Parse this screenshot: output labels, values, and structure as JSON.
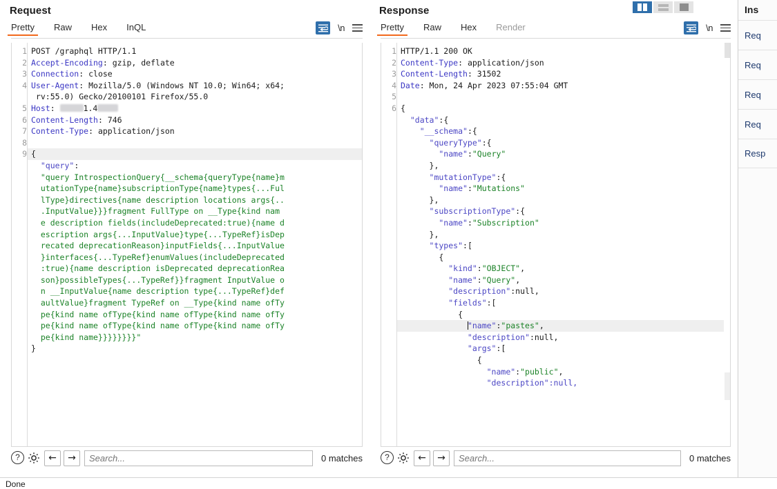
{
  "request": {
    "title": "Request",
    "tabs": [
      {
        "label": "Pretty",
        "active": true,
        "disabled": false
      },
      {
        "label": "Raw",
        "active": false,
        "disabled": false
      },
      {
        "label": "Hex",
        "active": false,
        "disabled": false
      },
      {
        "label": "InQL",
        "active": false,
        "disabled": false
      }
    ],
    "tools": {
      "wrap": "word-wrap-toggle",
      "newline": "\\n",
      "menu": "hamburger-menu"
    },
    "lines": [
      {
        "n": "1",
        "segments": [
          {
            "t": "POST /graphql HTTP/1.1",
            "c": "punct"
          }
        ]
      },
      {
        "n": "2",
        "segments": [
          {
            "t": "Accept-Encoding",
            "c": "hdr-name"
          },
          {
            "t": ": gzip, deflate",
            "c": "hdr-val"
          }
        ]
      },
      {
        "n": "3",
        "segments": [
          {
            "t": "Connection",
            "c": "hdr-name"
          },
          {
            "t": ": close",
            "c": "hdr-val"
          }
        ]
      },
      {
        "n": "4",
        "segments": [
          {
            "t": "User-Agent",
            "c": "hdr-name"
          },
          {
            "t": ": Mozilla/5.0 (Windows NT 10.0; Win64; x64;",
            "c": "hdr-val"
          }
        ]
      },
      {
        "n": "",
        "segments": [
          {
            "t": " rv:55.0) Gecko/20100101 Firefox/55.0",
            "c": "hdr-val"
          }
        ]
      },
      {
        "n": "5",
        "segments": [
          {
            "t": "Host",
            "c": "hdr-name"
          },
          {
            "t": ": ",
            "c": "hdr-val"
          },
          {
            "t": "REDACT:34",
            "c": "redact"
          },
          {
            "t": "1.4",
            "c": "hdr-val"
          },
          {
            "t": "REDACT:30",
            "c": "redact"
          }
        ]
      },
      {
        "n": "6",
        "segments": [
          {
            "t": "Content-Length",
            "c": "hdr-name"
          },
          {
            "t": ": 746",
            "c": "hdr-val"
          }
        ]
      },
      {
        "n": "7",
        "segments": [
          {
            "t": "Content-Type",
            "c": "hdr-name"
          },
          {
            "t": ": application/json",
            "c": "hdr-val"
          }
        ]
      },
      {
        "n": "8",
        "segments": []
      },
      {
        "n": "9",
        "highlight": true,
        "segments": [
          {
            "t": "{",
            "c": "punct"
          }
        ]
      },
      {
        "n": "",
        "segments": [
          {
            "t": "  \"query\"",
            "c": "jkey"
          },
          {
            "t": ":",
            "c": "punct"
          }
        ]
      },
      {
        "n": "",
        "segments": [
          {
            "t": "  \"query IntrospectionQuery{__schema{queryType{name}m",
            "c": "gq"
          }
        ]
      },
      {
        "n": "",
        "segments": [
          {
            "t": "  utationType{name}subscriptionType{name}types{...Ful",
            "c": "gq"
          }
        ]
      },
      {
        "n": "",
        "segments": [
          {
            "t": "  lType}directives{name description locations args{..",
            "c": "gq"
          }
        ]
      },
      {
        "n": "",
        "segments": [
          {
            "t": "  .InputValue}}}fragment FullType on __Type{kind nam",
            "c": "gq"
          }
        ]
      },
      {
        "n": "",
        "segments": [
          {
            "t": "  e description fields(includeDeprecated:true){name d",
            "c": "gq"
          }
        ]
      },
      {
        "n": "",
        "segments": [
          {
            "t": "  escription args{...InputValue}type{...TypeRef}isDep",
            "c": "gq"
          }
        ]
      },
      {
        "n": "",
        "segments": [
          {
            "t": "  recated deprecationReason}inputFields{...InputValue",
            "c": "gq"
          }
        ]
      },
      {
        "n": "",
        "segments": [
          {
            "t": "  }interfaces{...TypeRef}enumValues(includeDeprecated",
            "c": "gq"
          }
        ]
      },
      {
        "n": "",
        "segments": [
          {
            "t": "  :true){name description isDeprecated deprecationRea",
            "c": "gq"
          }
        ]
      },
      {
        "n": "",
        "segments": [
          {
            "t": "  son}possibleTypes{...TypeRef}}fragment InputValue o",
            "c": "gq"
          }
        ]
      },
      {
        "n": "",
        "segments": [
          {
            "t": "  n __InputValue{name description type{...TypeRef}def",
            "c": "gq"
          }
        ]
      },
      {
        "n": "",
        "segments": [
          {
            "t": "  aultValue}fragment TypeRef on __Type{kind name ofTy",
            "c": "gq"
          }
        ]
      },
      {
        "n": "",
        "segments": [
          {
            "t": "  pe{kind name ofType{kind name ofType{kind name ofTy",
            "c": "gq"
          }
        ]
      },
      {
        "n": "",
        "segments": [
          {
            "t": "  pe{kind name ofType{kind name ofType{kind name ofTy",
            "c": "gq"
          }
        ]
      },
      {
        "n": "",
        "segments": [
          {
            "t": "  pe{kind name}}}}}}}}\"",
            "c": "gq"
          }
        ]
      },
      {
        "n": "",
        "segments": [
          {
            "t": "}",
            "c": "punct"
          }
        ]
      }
    ],
    "search": {
      "placeholder": "Search...",
      "value": "",
      "matches": "0 matches"
    },
    "footer_icons": {
      "help": "?",
      "settings": "gear",
      "prev": "←",
      "next": "→"
    }
  },
  "response": {
    "title": "Response",
    "tabs": [
      {
        "label": "Pretty",
        "active": true,
        "disabled": false
      },
      {
        "label": "Raw",
        "active": false,
        "disabled": false
      },
      {
        "label": "Hex",
        "active": false,
        "disabled": false
      },
      {
        "label": "Render",
        "active": false,
        "disabled": true
      }
    ],
    "tools": {
      "wrap": "word-wrap-toggle",
      "newline": "\\n",
      "menu": "hamburger-menu"
    },
    "lines": [
      {
        "n": "1",
        "segments": [
          {
            "t": "HTTP/1.1 200 OK",
            "c": "punct"
          }
        ]
      },
      {
        "n": "2",
        "segments": [
          {
            "t": "Content-Type",
            "c": "hdr-name"
          },
          {
            "t": ": application/json",
            "c": "hdr-val"
          }
        ]
      },
      {
        "n": "3",
        "segments": [
          {
            "t": "Content-Length",
            "c": "hdr-name"
          },
          {
            "t": ": 31502",
            "c": "hdr-val"
          }
        ]
      },
      {
        "n": "4",
        "segments": [
          {
            "t": "Date",
            "c": "hdr-name"
          },
          {
            "t": ": Mon, 24 Apr 2023 07:55:04 GMT",
            "c": "hdr-val"
          }
        ]
      },
      {
        "n": "5",
        "segments": []
      },
      {
        "n": "6",
        "segments": [
          {
            "t": "{",
            "c": "punct"
          }
        ]
      },
      {
        "n": "",
        "segments": [
          {
            "t": "  \"data\"",
            "c": "jkey"
          },
          {
            "t": ":{",
            "c": "punct"
          }
        ]
      },
      {
        "n": "",
        "segments": [
          {
            "t": "    \"__schema\"",
            "c": "jkey"
          },
          {
            "t": ":{",
            "c": "punct"
          }
        ]
      },
      {
        "n": "",
        "segments": [
          {
            "t": "      \"queryType\"",
            "c": "jkey"
          },
          {
            "t": ":{",
            "c": "punct"
          }
        ]
      },
      {
        "n": "",
        "segments": [
          {
            "t": "        \"name\"",
            "c": "jkey"
          },
          {
            "t": ":",
            "c": "punct"
          },
          {
            "t": "\"Query\"",
            "c": "jstr"
          }
        ]
      },
      {
        "n": "",
        "segments": [
          {
            "t": "      },",
            "c": "punct"
          }
        ]
      },
      {
        "n": "",
        "segments": [
          {
            "t": "      \"mutationType\"",
            "c": "jkey"
          },
          {
            "t": ":{",
            "c": "punct"
          }
        ]
      },
      {
        "n": "",
        "segments": [
          {
            "t": "        \"name\"",
            "c": "jkey"
          },
          {
            "t": ":",
            "c": "punct"
          },
          {
            "t": "\"Mutations\"",
            "c": "jstr"
          }
        ]
      },
      {
        "n": "",
        "segments": [
          {
            "t": "      },",
            "c": "punct"
          }
        ]
      },
      {
        "n": "",
        "segments": [
          {
            "t": "      \"subscriptionType\"",
            "c": "jkey"
          },
          {
            "t": ":{",
            "c": "punct"
          }
        ]
      },
      {
        "n": "",
        "segments": [
          {
            "t": "        \"name\"",
            "c": "jkey"
          },
          {
            "t": ":",
            "c": "punct"
          },
          {
            "t": "\"Subscription\"",
            "c": "jstr"
          }
        ]
      },
      {
        "n": "",
        "segments": [
          {
            "t": "      },",
            "c": "punct"
          }
        ]
      },
      {
        "n": "",
        "segments": [
          {
            "t": "      \"types\"",
            "c": "jkey"
          },
          {
            "t": ":[",
            "c": "punct"
          }
        ]
      },
      {
        "n": "",
        "segments": [
          {
            "t": "        {",
            "c": "punct"
          }
        ]
      },
      {
        "n": "",
        "segments": [
          {
            "t": "          \"kind\"",
            "c": "jkey"
          },
          {
            "t": ":",
            "c": "punct"
          },
          {
            "t": "\"OBJECT\"",
            "c": "jstr"
          },
          {
            "t": ",",
            "c": "punct"
          }
        ]
      },
      {
        "n": "",
        "segments": [
          {
            "t": "          \"name\"",
            "c": "jkey"
          },
          {
            "t": ":",
            "c": "punct"
          },
          {
            "t": "\"Query\"",
            "c": "jstr"
          },
          {
            "t": ",",
            "c": "punct"
          }
        ]
      },
      {
        "n": "",
        "segments": [
          {
            "t": "          \"description\"",
            "c": "jkey"
          },
          {
            "t": ":null,",
            "c": "punct"
          }
        ]
      },
      {
        "n": "",
        "segments": [
          {
            "t": "          \"fields\"",
            "c": "jkey"
          },
          {
            "t": ":[",
            "c": "punct"
          }
        ]
      },
      {
        "n": "",
        "segments": [
          {
            "t": "            {",
            "c": "punct"
          }
        ]
      },
      {
        "n": "",
        "highlight": true,
        "caret": true,
        "segments": [
          {
            "t": "              \"name\"",
            "c": "jkey"
          },
          {
            "t": ":",
            "c": "punct"
          },
          {
            "t": "\"pastes\"",
            "c": "jstr"
          },
          {
            "t": ",",
            "c": "punct"
          }
        ]
      },
      {
        "n": "",
        "segments": [
          {
            "t": "              \"description\"",
            "c": "jkey"
          },
          {
            "t": ":null,",
            "c": "punct"
          }
        ]
      },
      {
        "n": "",
        "segments": [
          {
            "t": "              \"args\"",
            "c": "jkey"
          },
          {
            "t": ":[",
            "c": "punct"
          }
        ]
      },
      {
        "n": "",
        "segments": [
          {
            "t": "                {",
            "c": "punct"
          }
        ]
      },
      {
        "n": "",
        "segments": [
          {
            "t": "                  \"name\"",
            "c": "jkey"
          },
          {
            "t": ":",
            "c": "punct"
          },
          {
            "t": "\"public\"",
            "c": "jstr"
          },
          {
            "t": ",",
            "c": "punct"
          }
        ]
      },
      {
        "n": "",
        "segments": [
          {
            "t": "                  \"description\":null,",
            "c": "jkey"
          }
        ]
      }
    ],
    "search": {
      "placeholder": "Search...",
      "value": "",
      "matches": "0 matches"
    },
    "footer_icons": {
      "help": "?",
      "settings": "gear",
      "prev": "←",
      "next": "→"
    }
  },
  "layout_toggles": [
    {
      "name": "side-by-side-layout",
      "selected": true
    },
    {
      "name": "stacked-layout",
      "selected": false
    },
    {
      "name": "tabbed-layout",
      "selected": false
    }
  ],
  "inspector": {
    "title": "Ins",
    "items": [
      "Req",
      "Req",
      "Req",
      "Req",
      "Resp"
    ]
  },
  "statusbar": {
    "text": "Done"
  },
  "colors": {
    "accent_orange": "#f2681b",
    "accent_blue": "#2f6fab",
    "header_name": "#3b37c4",
    "json_key": "#4b46c4",
    "json_string": "#1b8227",
    "graphql": "#1b8227",
    "highlight_row": "#efefef"
  }
}
